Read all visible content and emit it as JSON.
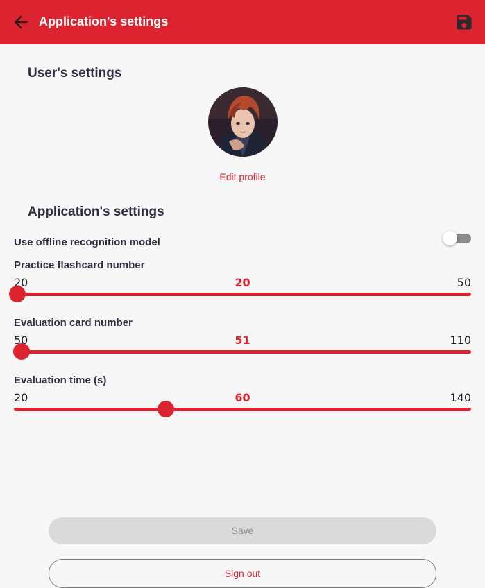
{
  "appbar": {
    "back_icon": "arrow-back-icon",
    "title": "Application's settings",
    "save_icon": "floppy-disk-icon",
    "color": "#db2430"
  },
  "user_section": {
    "title": "User's settings",
    "avatar": "anime-character-avatar",
    "edit_profile_label": "Edit profile"
  },
  "app_section": {
    "title": "Application's settings",
    "offline_model": {
      "label": "Use offline recognition model",
      "enabled": false
    },
    "sliders": [
      {
        "label": "Practice flashcard number",
        "min": "20",
        "max": "50",
        "value": "20"
      },
      {
        "label": "Evaluation card number",
        "min": "50",
        "max": "110",
        "value": "51"
      },
      {
        "label": "Evaluation time (s)",
        "min": "20",
        "max": "140",
        "value": "60"
      }
    ]
  },
  "buttons": {
    "save_label": "Save",
    "signout_label": "Sign out"
  },
  "colors": {
    "accent": "#db2430",
    "text": "#2f2e41",
    "background": "#f7f7f7"
  }
}
